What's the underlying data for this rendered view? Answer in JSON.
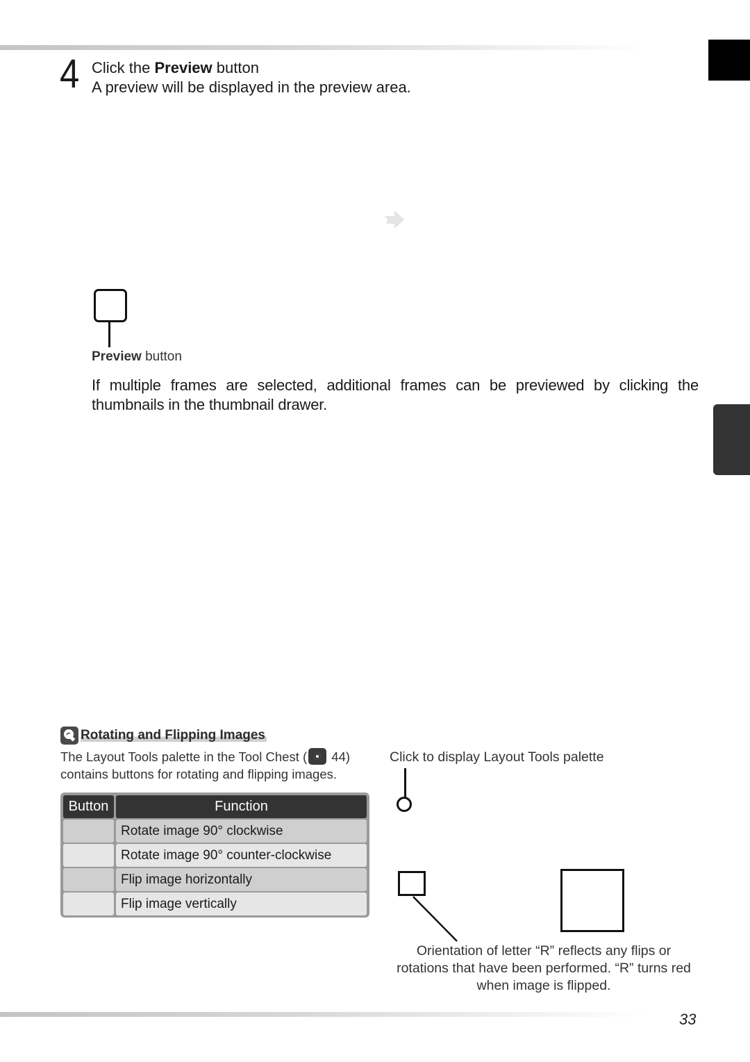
{
  "step": {
    "number": "4",
    "title_prefix": "Click the ",
    "title_bold": "Preview",
    "title_suffix": " button",
    "description": "A preview will be displayed in the preview area."
  },
  "preview_callout": {
    "label_bold": "Preview",
    "label_rest": " button"
  },
  "paragraph": "If multiple frames are selected, additional frames can be previewed by clicking the thumbnails in the thumbnail drawer.",
  "tip": {
    "icon": "tip-bulb-icon",
    "heading": "Rotating and Flipping Images",
    "text_before_ref": "The Layout Tools palette in the Tool Chest (",
    "ref_icon": "eye-reference-icon",
    "ref_page": " 44)",
    "text_after_ref": "contains buttons for rotating and flipping images."
  },
  "table": {
    "headers": [
      "Button",
      "Function"
    ],
    "rows": [
      {
        "function": "Rotate image 90° clockwise"
      },
      {
        "function": "Rotate image 90° counter-clockwise"
      },
      {
        "function": "Flip image horizontally"
      },
      {
        "function": "Flip image vertically"
      }
    ]
  },
  "layout_tools_callout": "Click to display Layout Tools palette",
  "orientation_note": "Orientation of letter “R” reflects any flips or rotations that have been performed. “R” turns red when image is flipped.",
  "page_number": "33",
  "colors": {
    "tab_top": "#000000",
    "tab_side": "#333333",
    "table_header": "#333333",
    "table_row_dark": "#cfcfcf",
    "table_row_light": "#e6e6e6"
  }
}
